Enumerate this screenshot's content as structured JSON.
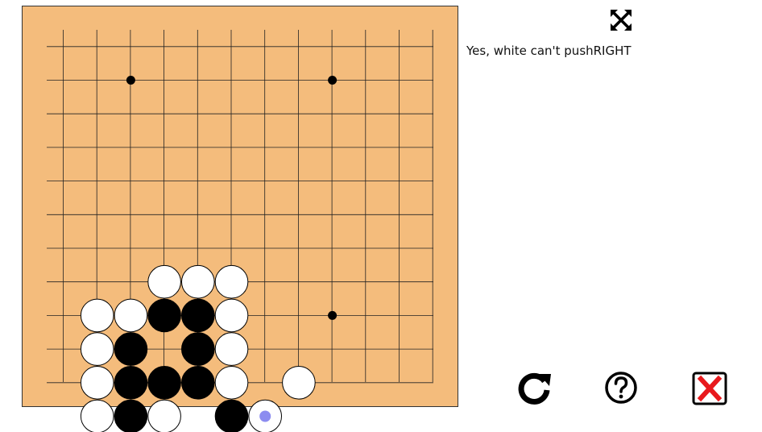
{
  "message": "Yes, white can't pushRIGHT",
  "colors": {
    "board": "#f4bc7c",
    "line": "#222222",
    "black_stone": "#000000",
    "white_stone": "#ffffff",
    "marker": "#8c8cf0",
    "close_red": "#e8191d"
  },
  "board": {
    "size": 13,
    "star_points": [
      [
        3,
        2
      ],
      [
        9,
        2
      ],
      [
        9,
        9
      ]
    ],
    "stones": [
      {
        "col": 4,
        "row": 8,
        "color": "white"
      },
      {
        "col": 5,
        "row": 8,
        "color": "white"
      },
      {
        "col": 6,
        "row": 8,
        "color": "white"
      },
      {
        "col": 2,
        "row": 9,
        "color": "white"
      },
      {
        "col": 3,
        "row": 9,
        "color": "white"
      },
      {
        "col": 4,
        "row": 9,
        "color": "black"
      },
      {
        "col": 5,
        "row": 9,
        "color": "black"
      },
      {
        "col": 6,
        "row": 9,
        "color": "white"
      },
      {
        "col": 2,
        "row": 10,
        "color": "white"
      },
      {
        "col": 3,
        "row": 10,
        "color": "black"
      },
      {
        "col": 5,
        "row": 10,
        "color": "black"
      },
      {
        "col": 6,
        "row": 10,
        "color": "white"
      },
      {
        "col": 2,
        "row": 11,
        "color": "white"
      },
      {
        "col": 3,
        "row": 11,
        "color": "black"
      },
      {
        "col": 4,
        "row": 11,
        "color": "black"
      },
      {
        "col": 5,
        "row": 11,
        "color": "black"
      },
      {
        "col": 6,
        "row": 11,
        "color": "white"
      },
      {
        "col": 8,
        "row": 11,
        "color": "white"
      },
      {
        "col": 2,
        "row": 12,
        "color": "white"
      },
      {
        "col": 3,
        "row": 12,
        "color": "black"
      },
      {
        "col": 4,
        "row": 12,
        "color": "white"
      },
      {
        "col": 6,
        "row": 12,
        "color": "black"
      },
      {
        "col": 7,
        "row": 12,
        "color": "white",
        "marked": true
      }
    ]
  },
  "icons": {
    "fullscreen": "fullscreen-arrows-icon",
    "reset": "reset-icon",
    "hint": "question-icon",
    "close": "close-x-icon"
  }
}
